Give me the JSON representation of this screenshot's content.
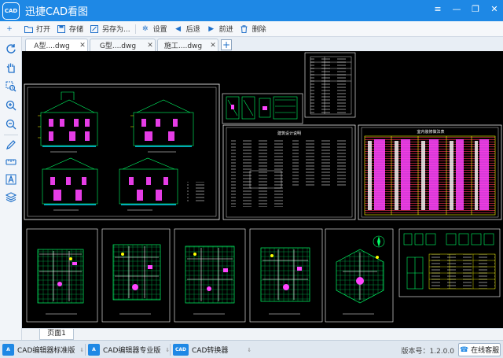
{
  "app": {
    "logo_text": "CAD",
    "title": "迅捷CAD看图"
  },
  "window_controls": {
    "menu": "≡",
    "minimize": "—",
    "restore": "❐",
    "close": "✕"
  },
  "toolbar": {
    "items": [
      {
        "name": "more",
        "label": "",
        "icon": "plus-icon"
      },
      {
        "name": "open",
        "label": "打开",
        "icon": "folder-open-icon"
      },
      {
        "name": "save",
        "label": "存储",
        "icon": "save-icon"
      },
      {
        "name": "save-as",
        "label": "另存为...",
        "icon": "save-as-icon"
      },
      {
        "name": "settings",
        "label": "设置",
        "icon": "gear-icon"
      },
      {
        "name": "back",
        "label": "后退",
        "icon": "arrow-left-icon"
      },
      {
        "name": "forward",
        "label": "前进",
        "icon": "arrow-right-icon"
      },
      {
        "name": "delete",
        "label": "删除",
        "icon": "trash-icon"
      }
    ]
  },
  "left_tools": [
    {
      "name": "rotate-tool",
      "icon": "rotate-icon"
    },
    {
      "name": "pan-tool",
      "icon": "hand-icon"
    },
    {
      "name": "zoom-window-tool",
      "icon": "zoom-window-icon"
    },
    {
      "name": "zoom-in-tool",
      "icon": "zoom-in-icon"
    },
    {
      "name": "zoom-out-tool",
      "icon": "zoom-out-icon"
    },
    {
      "name": "draw-tool",
      "icon": "pencil-icon"
    },
    {
      "name": "measure-tool",
      "icon": "ruler-icon"
    },
    {
      "name": "text-tool",
      "icon": "text-icon"
    },
    {
      "name": "layers-tool",
      "icon": "layers-icon"
    }
  ],
  "tabs": [
    {
      "label": "A型....dwg",
      "active": true
    },
    {
      "label": "G型....dwg",
      "active": false
    },
    {
      "label": "施工....dwg",
      "active": false
    }
  ],
  "drawing": {
    "sheet_titles": [
      "建筑设计说明",
      "室内装修做法表"
    ]
  },
  "page_tabs": [
    "页面1"
  ],
  "statusbar": {
    "products": [
      {
        "label": "CAD编辑器标准版",
        "icon_text": "A"
      },
      {
        "label": "CAD编辑器专业版",
        "icon_text": "A"
      },
      {
        "label": "CAD转换器",
        "icon_text": "CAD"
      }
    ],
    "version": "版本号：1.2.0.0",
    "service": "在线客服"
  },
  "colors": {
    "titlebar": "#1e88e5",
    "canvas": "#000000",
    "cad_green": "#00ff00",
    "cad_white": "#ffffff",
    "cad_magenta": "#ff33ff",
    "cad_yellow": "#ffff00",
    "cad_cyan": "#00ffff"
  }
}
